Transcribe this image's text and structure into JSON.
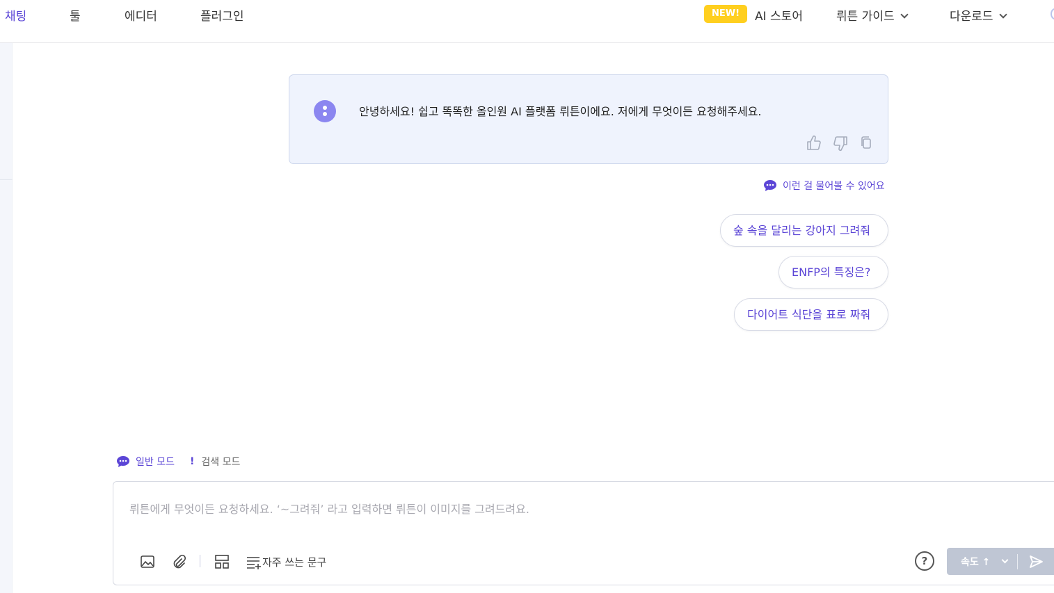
{
  "nav": {
    "items": [
      {
        "label": "채팅",
        "active": true
      },
      {
        "label": "툴"
      },
      {
        "label": "에디터"
      },
      {
        "label": "플러그인"
      }
    ],
    "new_badge": "NEW!",
    "ai_store": "AI 스토어",
    "guide": "뤼튼 가이드",
    "download": "다운로드"
  },
  "chat": {
    "bot_message": "안녕하세요! 쉽고 똑똑한 올인원 AI 플랫폼 뤼튼이에요. 저에게 무엇이든 요청해주세요.",
    "suggest_title": "이런 걸 물어볼 수 있어요",
    "suggestions": [
      "숲 속을 달리는 강아지 그려줘",
      "ENFP의 특징은?",
      "다이어트 식단을 표로 짜줘"
    ]
  },
  "modes": {
    "active": "일반 모드",
    "separator": "!",
    "other": "검색 모드"
  },
  "composer": {
    "placeholder": "뤼튼에게 무엇이든 요청하세요.  ‘~그려줘’ 라고 입력하면 뤼튼이 이미지를 그려드려요.",
    "phrase_label": "자주 쓰는 문구",
    "help": "?",
    "speed_label": "속도 ↑"
  },
  "colors": {
    "accent": "#5b45d6",
    "badge": "#ffcf1f",
    "card_bg": "#eff3fd",
    "avatar": "#8b86f0",
    "send_disabled": "#bfc6d4"
  },
  "icons": [
    "thumbs-up-icon",
    "thumbs-down-icon",
    "copy-icon",
    "chat-bubble-icon",
    "image-icon",
    "paperclip-icon",
    "layout-icon",
    "list-add-icon",
    "help-icon",
    "chevron-down-icon",
    "send-icon"
  ]
}
